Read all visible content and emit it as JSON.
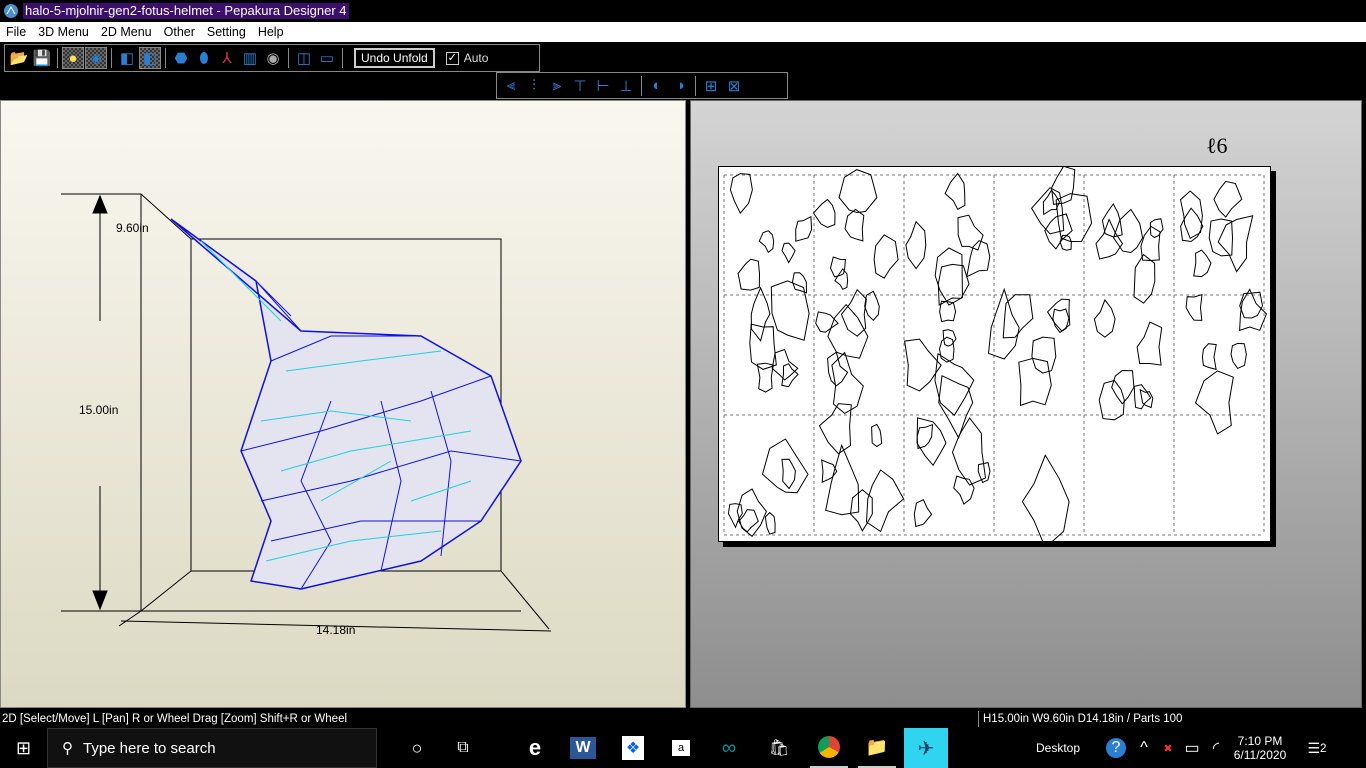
{
  "window": {
    "title": "halo-5-mjolnir-gen2-fotus-helmet - Pepakura Designer 4"
  },
  "menu": [
    "File",
    "3D Menu",
    "2D Menu",
    "Other",
    "Setting",
    "Help"
  ],
  "toolbar": {
    "undo_unfold": "Undo Unfold",
    "auto_label": "Auto",
    "auto_checked": true
  },
  "view3d": {
    "height_label": "15.00in",
    "width_label": "9.60in",
    "depth_label": "14.18in"
  },
  "view2d": {
    "corner_mark": "ℓ6",
    "columns": 6,
    "rows": 3
  },
  "status": {
    "left": "2D [Select/Move] L [Pan] R or Wheel Drag [Zoom] Shift+R or Wheel",
    "right": "H15.00in W9.60in D14.18in / Parts 100"
  },
  "taskbar": {
    "search_placeholder": "Type here to search",
    "desktop_label": "Desktop",
    "time": "7:10 PM",
    "date": "6/11/2020",
    "notification_count": "2"
  }
}
